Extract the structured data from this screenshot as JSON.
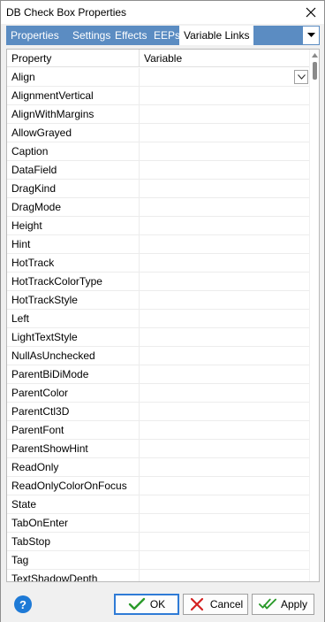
{
  "window": {
    "title": "DB Check Box Properties"
  },
  "tabs": [
    {
      "label": "Properties"
    },
    {
      "label": "Settings"
    },
    {
      "label": "Effects"
    },
    {
      "label": "EEPs"
    },
    {
      "label": "Variable Links"
    }
  ],
  "grid": {
    "headers": {
      "property": "Property",
      "variable": "Variable"
    },
    "rows": [
      {
        "property": "Align",
        "variable": ""
      },
      {
        "property": "AlignmentVertical",
        "variable": ""
      },
      {
        "property": "AlignWithMargins",
        "variable": ""
      },
      {
        "property": "AllowGrayed",
        "variable": ""
      },
      {
        "property": "Caption",
        "variable": ""
      },
      {
        "property": "DataField",
        "variable": ""
      },
      {
        "property": "DragKind",
        "variable": ""
      },
      {
        "property": "DragMode",
        "variable": ""
      },
      {
        "property": "Height",
        "variable": ""
      },
      {
        "property": "Hint",
        "variable": ""
      },
      {
        "property": "HotTrack",
        "variable": ""
      },
      {
        "property": "HotTrackColorType",
        "variable": ""
      },
      {
        "property": "HotTrackStyle",
        "variable": ""
      },
      {
        "property": "Left",
        "variable": ""
      },
      {
        "property": "LightTextStyle",
        "variable": ""
      },
      {
        "property": "NullAsUnchecked",
        "variable": ""
      },
      {
        "property": "ParentBiDiMode",
        "variable": ""
      },
      {
        "property": "ParentColor",
        "variable": ""
      },
      {
        "property": "ParentCtl3D",
        "variable": ""
      },
      {
        "property": "ParentFont",
        "variable": ""
      },
      {
        "property": "ParentShowHint",
        "variable": ""
      },
      {
        "property": "ReadOnly",
        "variable": ""
      },
      {
        "property": "ReadOnlyColorOnFocus",
        "variable": ""
      },
      {
        "property": "State",
        "variable": ""
      },
      {
        "property": "TabOnEnter",
        "variable": ""
      },
      {
        "property": "TabStop",
        "variable": ""
      },
      {
        "property": "Tag",
        "variable": ""
      },
      {
        "property": "TextShadowDepth",
        "variable": ""
      }
    ]
  },
  "footer": {
    "help_label": "?",
    "ok_label": "OK",
    "cancel_label": "Cancel",
    "apply_label": "Apply"
  },
  "colors": {
    "tab_strip": "#5b8cc2",
    "ok_border": "#2f7bd6",
    "help": "#1e7ad6",
    "check_green": "#2a9a2a",
    "cancel_red": "#d42020"
  }
}
